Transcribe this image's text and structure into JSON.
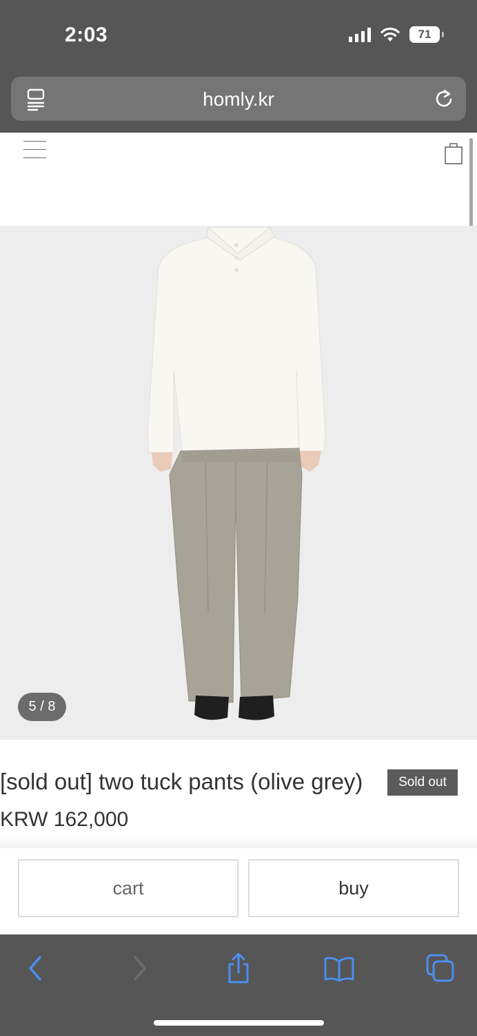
{
  "status_bar": {
    "time": "2:03",
    "battery": "71"
  },
  "browser": {
    "url": "homly.kr"
  },
  "product": {
    "slide_counter": "5 / 8",
    "title": "[sold out] two tuck pants (olive grey)",
    "badge": "Sold out",
    "price": "KRW 162,000"
  },
  "actions": {
    "cart_label": "cart",
    "buy_label": "buy"
  },
  "colors": {
    "chrome": "#565656",
    "toolbar_icon_active": "#4a8ff0",
    "toolbar_icon_disabled": "#6d6d6d"
  }
}
